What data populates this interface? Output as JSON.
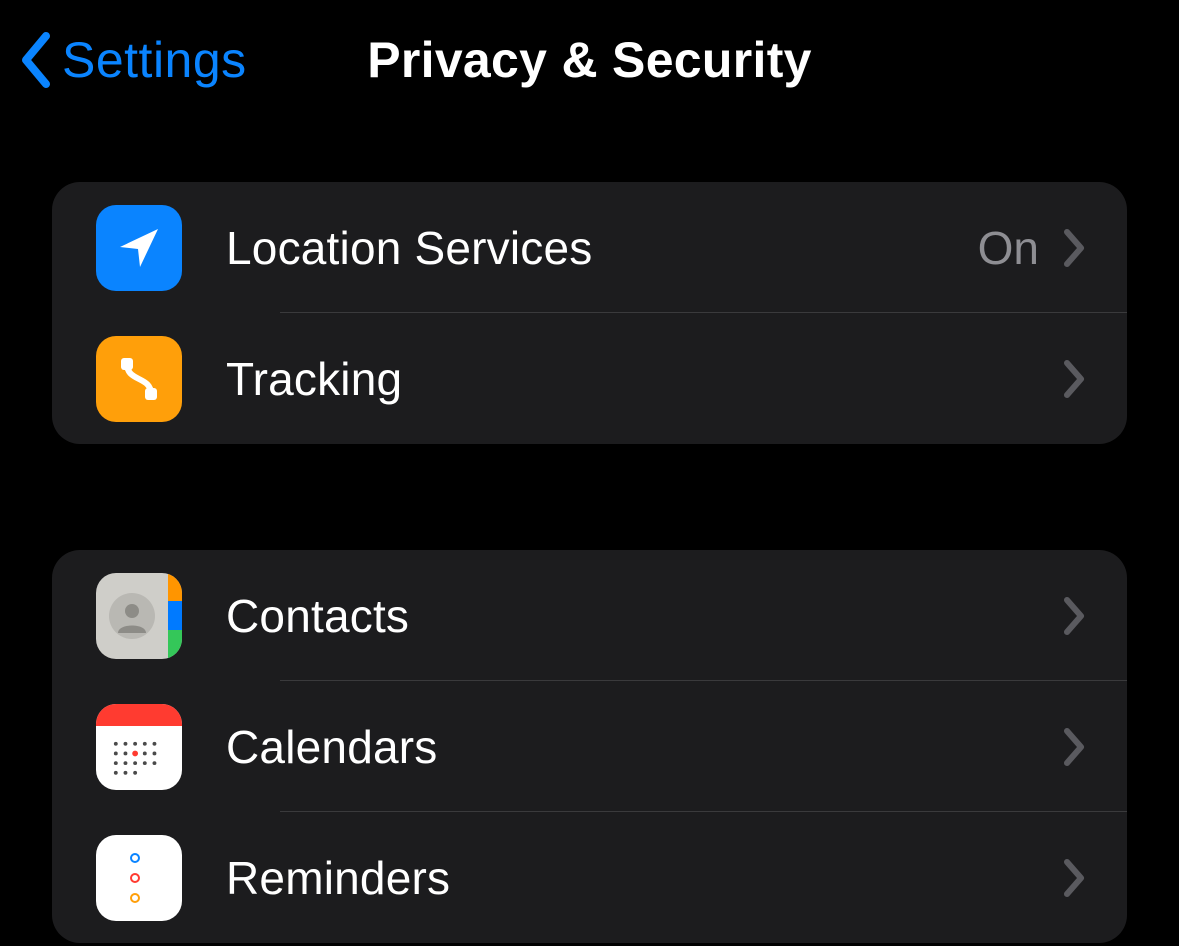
{
  "header": {
    "back_label": "Settings",
    "title": "Privacy & Security"
  },
  "groups": [
    {
      "rows": [
        {
          "icon": "location-arrow-icon",
          "label": "Location Services",
          "value": "On"
        },
        {
          "icon": "tracking-icon",
          "label": "Tracking",
          "value": ""
        }
      ]
    },
    {
      "rows": [
        {
          "icon": "contacts-icon",
          "label": "Contacts",
          "value": ""
        },
        {
          "icon": "calendars-icon",
          "label": "Calendars",
          "value": ""
        },
        {
          "icon": "reminders-icon",
          "label": "Reminders",
          "value": ""
        }
      ]
    }
  ]
}
